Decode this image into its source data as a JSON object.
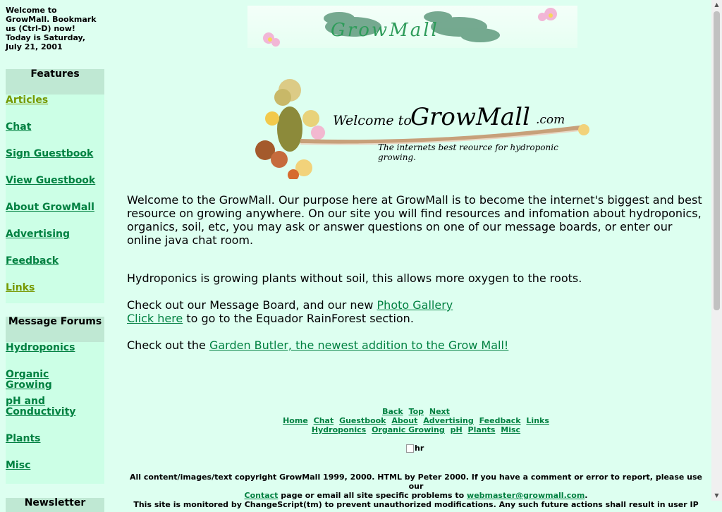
{
  "sidebar": {
    "welcome": "Welcome to GrowMall. Bookmark us (Ctrl-D) now! Today is Saturday, July 21, 2001",
    "features": {
      "title": "Features",
      "items": [
        "Articles",
        "Chat",
        "Sign Guestbook",
        "View Guestbook",
        "About GrowMall",
        "Advertising",
        "Feedback",
        "Links"
      ]
    },
    "forums": {
      "title": "Message Forums",
      "items": [
        "Hydroponics",
        "Organic Growing",
        "pH and Conductivity",
        "Plants",
        "Misc"
      ]
    },
    "next_box_title": "Newsletter"
  },
  "banner": {
    "text": "GrowMall"
  },
  "logo": {
    "welcome": "Welcome to",
    "brand": "GrowMall",
    "tld": ".com",
    "tagline": "The internets best reource for hydroponic growing."
  },
  "main": {
    "intro": "Welcome to the GrowMall. Our purpose here at GrowMall is to become the internet's biggest and best resource on growing anywhere. On our site you will find resources and infomation about hydroponics, organics, soil, etc, you may ask or answer questions on one of our message boards, or enter our online java chat room.",
    "hydro": "Hydroponics is growing plants without soil, this allows more oxygen to the roots.",
    "board_prefix": "Check out our Message Board, and our new ",
    "photo_link": "Photo Gallery",
    "click_here": "Click here",
    "rainforest_suffix": " to go to the Equador RainForest section.",
    "butler_prefix": "Check out the ",
    "butler_link": "Garden Butler, the newest addition to the Grow Mall!"
  },
  "footer": {
    "row1": [
      "Back",
      "Top",
      "Next"
    ],
    "row2": [
      "Home",
      "Chat",
      "Guestbook",
      "About",
      "Advertising",
      "Feedback",
      "Links"
    ],
    "row3": [
      "Hydroponics",
      "Organic Growing",
      "pH",
      "Plants",
      "Misc"
    ],
    "hr_alt": "hr",
    "copy_1": "All content/images/text copyright GrowMall 1999, 2000. HTML by Peter 2000. If you have a comment or error to report, please use our",
    "contact_link": "Contact",
    "copy_2": " page or email all site specific problems to ",
    "email_link": "webmaster@growmall.com",
    "copy_3": ".",
    "copy_4": "This site is monitored by ChangeScript(tm) to prevent unauthorized modifications. Any such future actions shall result in user IP"
  },
  "colors": {
    "background": "#ddfff0",
    "link": "#008040",
    "sidebar_box": "#ccffe6",
    "sidebar_header": "#bfe8d3"
  }
}
